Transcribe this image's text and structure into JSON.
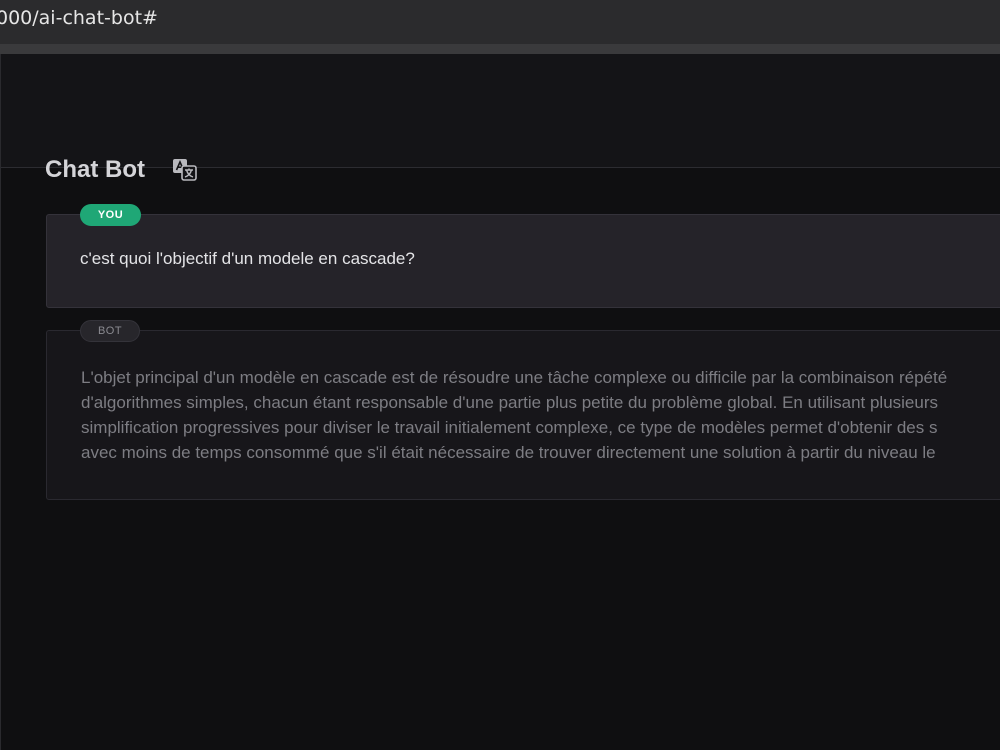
{
  "browser": {
    "url": "000/ai-chat-bot#"
  },
  "header": {
    "title": "Chat Bot",
    "translate_icon": "translate-icon"
  },
  "messages": {
    "user": {
      "badge": "YOU",
      "text": "c'est quoi l'objectif d'un modele en cascade?"
    },
    "bot": {
      "badge": "BOT",
      "lines": [
        "L'objet principal d'un modèle en cascade est de résoudre une tâche complexe ou difficile par la combinaison répété",
        "d'algorithmes simples, chacun étant responsable d'une partie plus petite du problème global. En utilisant plusieurs",
        "simplification progressives pour diviser le travail initialement complexe, ce type de modèles permet d'obtenir des s",
        "avec moins de temps consommé que s'il était nécessaire de trouver directement une solution à partir du niveau le"
      ]
    }
  },
  "colors": {
    "accent": "#1fa776",
    "background": "#0f0f11",
    "user_bubble": "#252329",
    "bot_bubble": "#17161a"
  }
}
